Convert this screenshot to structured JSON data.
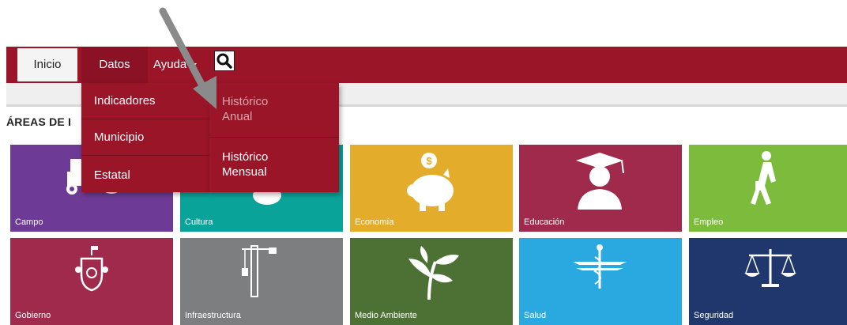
{
  "nav": {
    "items": [
      {
        "label": "Inicio"
      },
      {
        "label": "Datos"
      },
      {
        "label": "Ayuda"
      }
    ],
    "search_icon": "search-icon"
  },
  "section_title": "ÁREAS DE I",
  "dropdown_datos": {
    "items": [
      {
        "label": "Indicadores"
      },
      {
        "label": "Municipio"
      },
      {
        "label": "Estatal"
      }
    ]
  },
  "dropdown_indicadores": {
    "items": [
      {
        "line1": "Histórico",
        "line2": "Anual"
      },
      {
        "line1": "Histórico",
        "line2": "Mensual"
      }
    ]
  },
  "tiles": [
    {
      "label": "Campo",
      "color": "#6d3b96",
      "icon": "tractor-icon"
    },
    {
      "label": "Cultura",
      "color": "#0aa39a",
      "icon": "culture-icon"
    },
    {
      "label": "Economía",
      "color": "#e3ac2a",
      "icon": "piggy-bank-icon"
    },
    {
      "label": "Educación",
      "color": "#a02a4b",
      "icon": "graduate-icon"
    },
    {
      "label": "Empleo",
      "color": "#7dbb3c",
      "icon": "walking-man-icon"
    },
    {
      "label": "Gobierno",
      "color": "#a02a4b",
      "icon": "coat-of-arms-icon"
    },
    {
      "label": "Infraestructura",
      "color": "#7d7e80",
      "icon": "crane-icon"
    },
    {
      "label": "Medio Ambiente",
      "color": "#4d7135",
      "icon": "plant-icon"
    },
    {
      "label": "Salud",
      "color": "#29a9e0",
      "icon": "caduceus-icon"
    },
    {
      "label": "Seguridad",
      "color": "#20376e",
      "icon": "scales-icon"
    }
  ]
}
